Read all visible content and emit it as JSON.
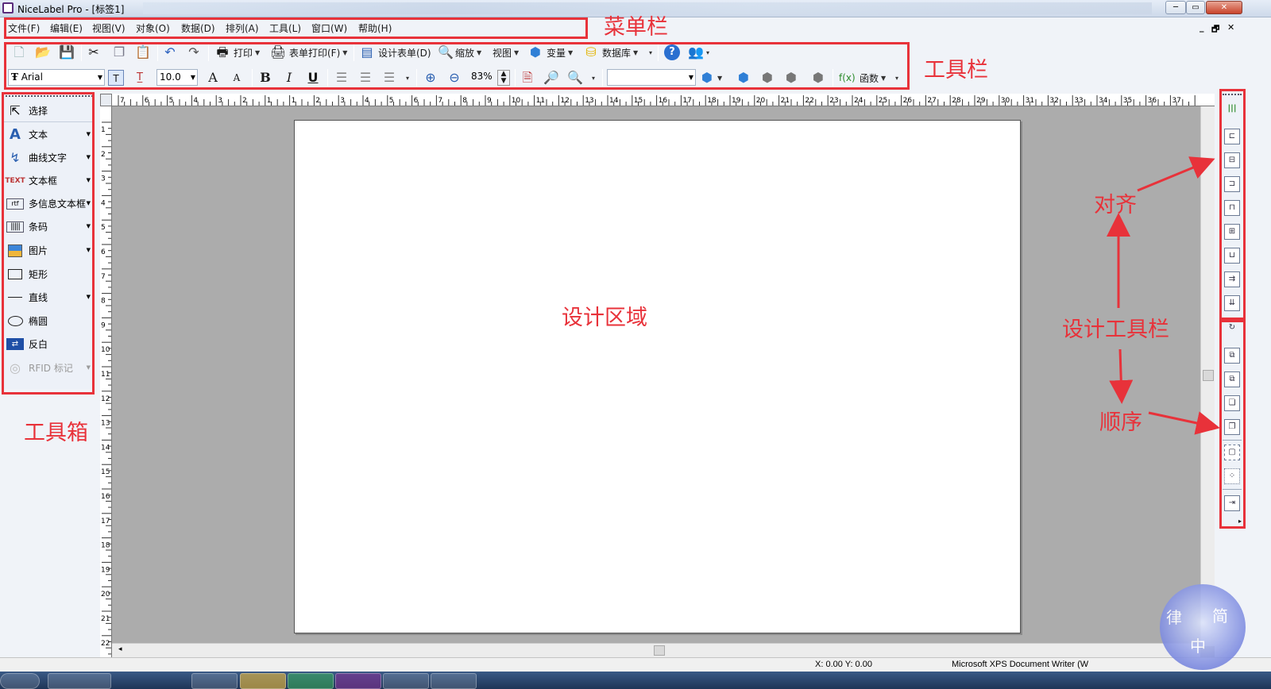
{
  "window": {
    "title": "NiceLabel Pro - [标签1]",
    "controls": {
      "minimize": "─",
      "maximize": "▭",
      "close": "✕"
    }
  },
  "menubar": {
    "items": [
      "文件(F)",
      "编辑(E)",
      "视图(V)",
      "对象(O)",
      "数据(D)",
      "排列(A)",
      "工具(L)",
      "窗口(W)",
      "帮助(H)"
    ],
    "mdi_buttons": [
      "_",
      "🗗",
      "✕"
    ]
  },
  "toolbar1": {
    "print": "打印",
    "form_print": "表单打印(F)",
    "design_form": "设计表单(D)",
    "zoom": "缩放",
    "view": "视图",
    "variables": "变量",
    "database": "数据库"
  },
  "toolbar2": {
    "font_name": "Arial",
    "font_size": "10.0",
    "zoom_value": "83%",
    "functions": "函数",
    "object_combo": ""
  },
  "toolbox": {
    "items": [
      {
        "label": "选择",
        "icon": "pointer-icon"
      },
      {
        "label": "文本",
        "icon": "text-icon"
      },
      {
        "label": "曲线文字",
        "icon": "curved-text-icon"
      },
      {
        "label": "文本框",
        "icon": "text-box-icon"
      },
      {
        "label": "多信息文本框",
        "icon": "rich-text-icon"
      },
      {
        "label": "条码",
        "icon": "barcode-icon"
      },
      {
        "label": "图片",
        "icon": "picture-icon"
      },
      {
        "label": "矩形",
        "icon": "rectangle-icon"
      },
      {
        "label": "直线",
        "icon": "line-icon"
      },
      {
        "label": "椭圆",
        "icon": "ellipse-icon"
      },
      {
        "label": "反白",
        "icon": "inverse-icon"
      },
      {
        "label": "RFID 标记",
        "icon": "rfid-icon"
      }
    ]
  },
  "rulers": {
    "horizontal": [
      "7",
      "6",
      "5",
      "4",
      "3",
      "2",
      "1",
      "1",
      "2",
      "3",
      "4",
      "5",
      "6",
      "7",
      "8",
      "9",
      "10",
      "11",
      "12",
      "13",
      "14",
      "15",
      "16",
      "17",
      "18",
      "19",
      "20",
      "21",
      "22",
      "23",
      "24",
      "25",
      "26",
      "27",
      "28",
      "29",
      "30",
      "31",
      "32",
      "33",
      "34",
      "35",
      "36",
      "37"
    ],
    "vertical": [
      "1",
      "2",
      "3",
      "4",
      "5",
      "6",
      "7",
      "8",
      "9",
      "10",
      "11",
      "12",
      "13",
      "14",
      "15",
      "16",
      "17",
      "18",
      "19",
      "20",
      "21",
      "22"
    ]
  },
  "statusbar": {
    "coords": "X: 0.00 Y: 0.00",
    "printer": "Microsoft XPS Document Writer (W"
  },
  "annotations": {
    "menubar": "菜单栏",
    "toolbar": "工具栏",
    "toolbox": "工具箱",
    "design_area": "设计区域",
    "align": "对齐",
    "design_toolbar": "设计工具栏",
    "order": "顺序"
  },
  "watermark": {
    "chars": [
      "律",
      "简",
      "中"
    ]
  },
  "colors": {
    "annotation": "#e8323a",
    "canvas_bg": "#acacac",
    "paper": "#ffffff"
  }
}
